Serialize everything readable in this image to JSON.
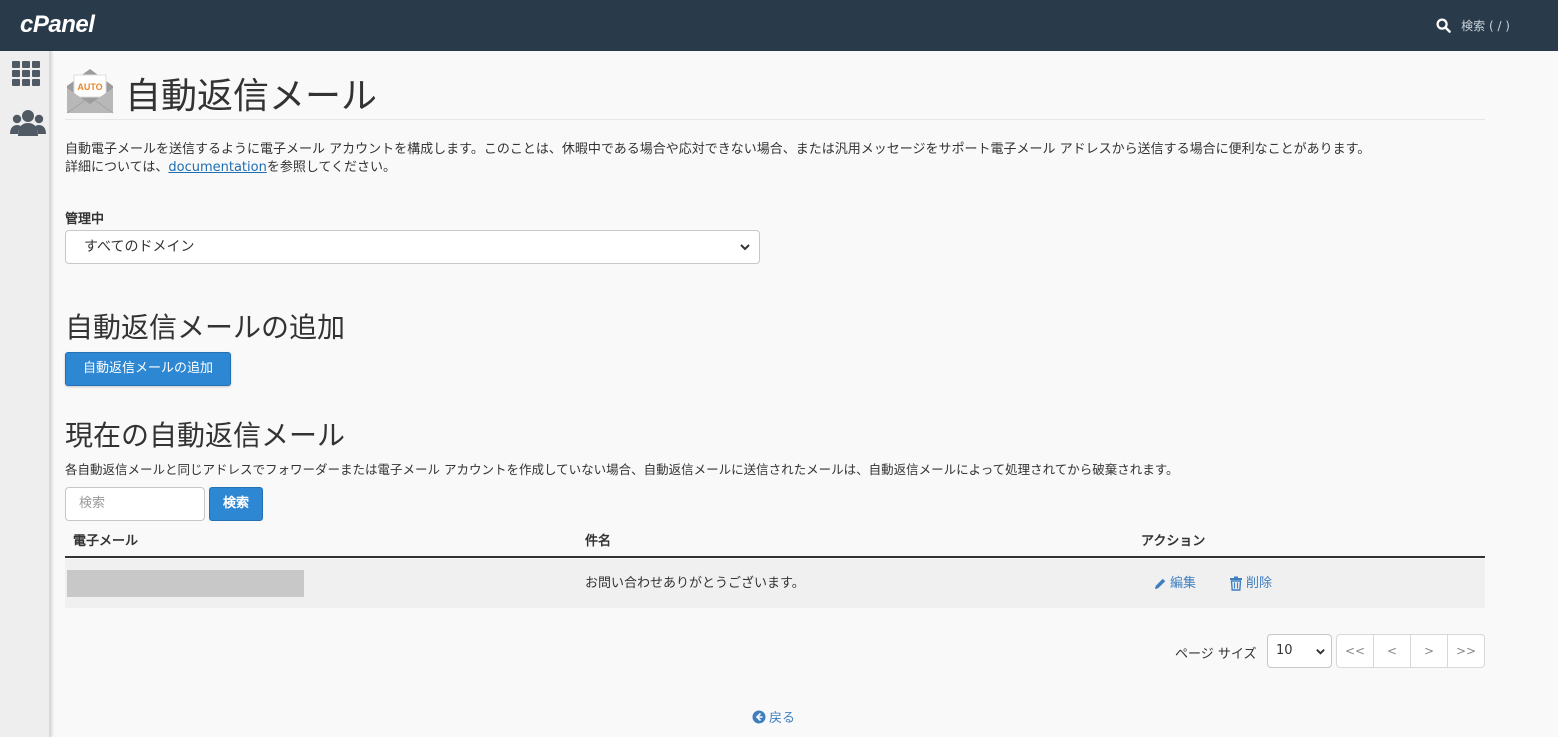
{
  "topbar": {
    "logo": "cPanel",
    "search_placeholder": "検索 ( / )"
  },
  "sidebar": {
    "items": [
      {
        "icon": "grid-icon"
      },
      {
        "icon": "users-icon"
      }
    ]
  },
  "header": {
    "icon_label": "AUTO",
    "title": "自動返信メール"
  },
  "intro": {
    "line1": "自動電子メールを送信するように電子メール アカウントを構成します。このことは、休暇中である場合や応対できない場合、または汎用メッセージをサポート電子メール アドレスから送信する場合に便利なことがあります。",
    "line2_prefix": "詳細については、",
    "link": "documentation",
    "line2_suffix": "を参照してください。"
  },
  "manage": {
    "label": "管理中",
    "selected": "すべてのドメイン"
  },
  "add_section": {
    "heading": "自動返信メールの追加",
    "button": "自動返信メールの追加"
  },
  "current_section": {
    "heading": "現在の自動返信メール",
    "description": "各自動返信メールと同じアドレスでフォワーダーまたは電子メール アカウントを作成していない場合、自動返信メールに送信されたメールは、自動返信メールによって処理されてから破棄されます。",
    "search_placeholder": "検索",
    "search_button": "検索"
  },
  "table": {
    "columns": [
      "電子メール",
      "件名",
      "アクション"
    ],
    "rows": [
      {
        "email": "",
        "subject": "お問い合わせありがとうございます。",
        "edit": "編集",
        "delete": "削除"
      }
    ]
  },
  "pagination": {
    "label": "ページ サイズ",
    "page_size": "10",
    "first": "<<",
    "prev": "<",
    "next": ">",
    "last": ">>"
  },
  "footer": {
    "back": "戻る"
  },
  "colors": {
    "topbar": "#293a4a",
    "primary": "#2e87d3",
    "link": "#3f7fbf"
  }
}
